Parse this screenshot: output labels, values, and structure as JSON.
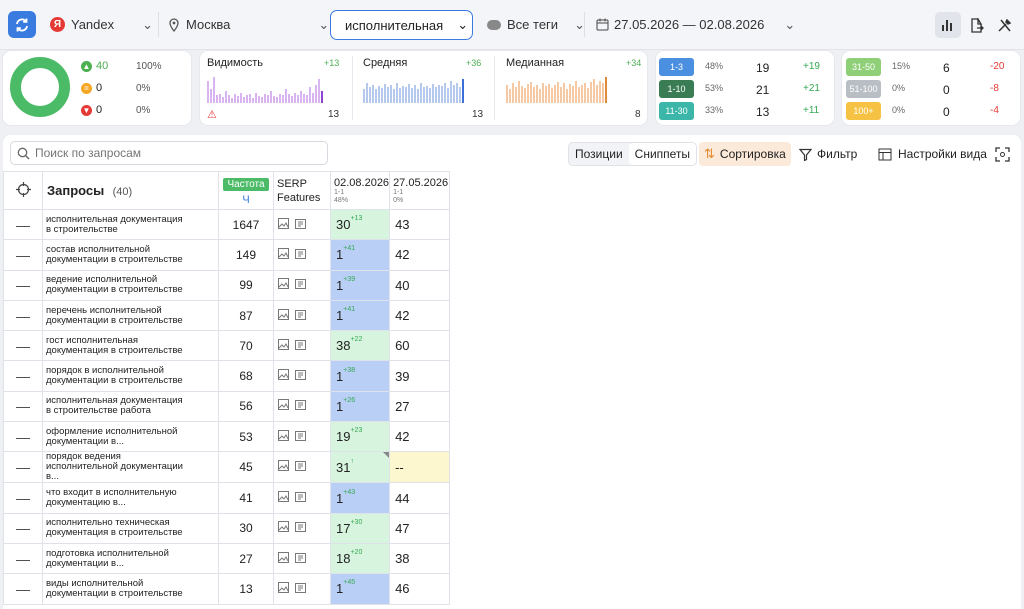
{
  "topbar": {
    "engine": "Yandex",
    "region": "Москва",
    "group": "исполнительная",
    "tags": "Все теги",
    "dates": "27.05.2026 — 02.08.2026"
  },
  "summary": {
    "up": {
      "value": "40",
      "pct": "100%"
    },
    "same": {
      "value": "0",
      "pct": "0%"
    },
    "down": {
      "value": "0",
      "pct": "0%"
    },
    "warn_count": "13"
  },
  "metrics": [
    {
      "name": "Видимость",
      "delta": "+13",
      "total": "13"
    },
    {
      "name": "Средняя",
      "delta": "+36",
      "total": "13"
    },
    {
      "name": "Медианная",
      "delta": "+34",
      "total": "8"
    }
  ],
  "ranges": [
    {
      "label": "1-3",
      "pct": "48%",
      "value": "19",
      "delta": "+19",
      "color": "#4a8fe0",
      "dcolor": "#34a853"
    },
    {
      "label": "1-10",
      "pct": "53%",
      "value": "21",
      "delta": "+21",
      "color": "#3a7d55",
      "dcolor": "#34a853"
    },
    {
      "label": "11-30",
      "pct": "33%",
      "value": "13",
      "delta": "+11",
      "color": "#3bb6a8",
      "dcolor": "#34a853"
    },
    {
      "label": "31-50",
      "pct": "15%",
      "value": "6",
      "delta": "-20",
      "color": "#8fcf78",
      "dcolor": "#e53935"
    },
    {
      "label": "51-100",
      "pct": "0%",
      "value": "0",
      "delta": "-8",
      "color": "#b9bdc4",
      "dcolor": "#e53935"
    },
    {
      "label": "100+",
      "pct": "0%",
      "value": "0",
      "delta": "-4",
      "color": "#f6c244",
      "dcolor": "#e53935"
    }
  ],
  "toolbar": {
    "search_placeholder": "Поиск по запросам",
    "tab_positions": "Позиции",
    "tab_snippets": "Сниппеты",
    "sort": "Сортировка",
    "filter": "Фильтр",
    "view_settings": "Настройки вида"
  },
  "table": {
    "queries_label": "Запросы",
    "queries_count": "(40)",
    "freq_badge": "Частота",
    "freq_sub": "Ч",
    "serp_label": "SERP Features",
    "col1": {
      "date": "02.08.2026",
      "range": "1-1",
      "pct": "48%"
    },
    "col2": {
      "date": "27.05.2026",
      "range": "1-1",
      "pct": "0%"
    },
    "rows": [
      {
        "q": "исполнительная документация в строительстве",
        "f": "1647",
        "p1": "30",
        "d1": "+13",
        "c1": "g",
        "p2": "43",
        "c2": ""
      },
      {
        "q": "состав исполнительной документации в строительстве",
        "f": "149",
        "p1": "1",
        "d1": "+41",
        "c1": "b",
        "p2": "42",
        "c2": ""
      },
      {
        "q": "ведение исполнительной документации в строительстве",
        "f": "99",
        "p1": "1",
        "d1": "+39",
        "c1": "b",
        "p2": "40",
        "c2": ""
      },
      {
        "q": "перечень исполнительной документации в строительстве",
        "f": "87",
        "p1": "1",
        "d1": "+41",
        "c1": "b",
        "p2": "42",
        "c2": ""
      },
      {
        "q": "гост исполнительная документация в строительстве",
        "f": "70",
        "p1": "38",
        "d1": "+22",
        "c1": "g",
        "p2": "60",
        "c2": ""
      },
      {
        "q": "порядок в исполнительной документации в строительстве",
        "f": "68",
        "p1": "1",
        "d1": "+38",
        "c1": "b",
        "p2": "39",
        "c2": ""
      },
      {
        "q": "исполнительная документация в строительстве работа",
        "f": "56",
        "p1": "1",
        "d1": "+26",
        "c1": "b",
        "p2": "27",
        "c2": ""
      },
      {
        "q": "оформление исполнительной документации в...",
        "f": "53",
        "p1": "19",
        "d1": "+23",
        "c1": "g",
        "p2": "42",
        "c2": ""
      },
      {
        "q": "порядок ведения исполнительной документации в...",
        "f": "45",
        "p1": "31",
        "d1": "↑",
        "c1": "g",
        "p2": "--",
        "c2": "y"
      },
      {
        "q": "что входит в исполнительную документацию в...",
        "f": "41",
        "p1": "1",
        "d1": "+43",
        "c1": "b",
        "p2": "44",
        "c2": ""
      },
      {
        "q": "исполнительно техническая документация в строительстве",
        "f": "30",
        "p1": "17",
        "d1": "+30",
        "c1": "g",
        "p2": "47",
        "c2": ""
      },
      {
        "q": "подготовка исполнительной документации в...",
        "f": "27",
        "p1": "18",
        "d1": "+20",
        "c1": "g",
        "p2": "38",
        "c2": ""
      },
      {
        "q": "виды исполнительной документации в строительстве",
        "f": "13",
        "p1": "1",
        "d1": "+45",
        "c1": "b",
        "p2": "46",
        "c2": ""
      }
    ]
  }
}
